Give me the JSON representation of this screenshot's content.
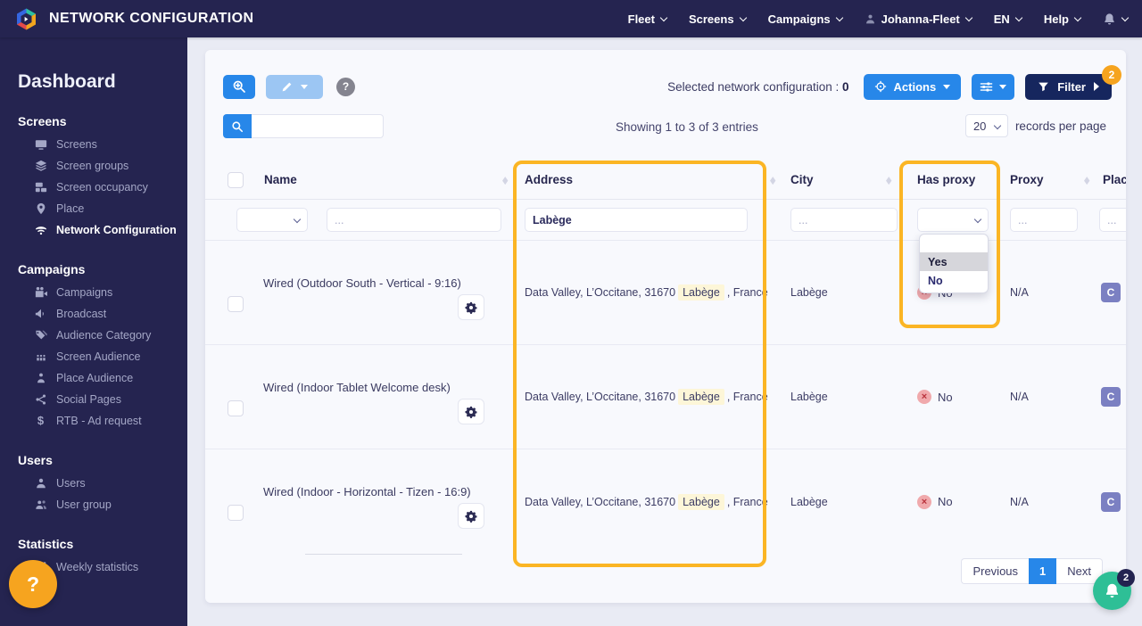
{
  "navbar": {
    "title": "NETWORK CONFIGURATION",
    "items": [
      {
        "label": "Fleet"
      },
      {
        "label": "Screens"
      },
      {
        "label": "Campaigns"
      },
      {
        "label": "Johanna-Fleet"
      },
      {
        "label": "EN"
      },
      {
        "label": "Help"
      }
    ]
  },
  "sidebar": {
    "dashboard": "Dashboard",
    "sections": [
      {
        "title": "Screens",
        "items": [
          {
            "label": "Screens"
          },
          {
            "label": "Screen groups"
          },
          {
            "label": "Screen occupancy"
          },
          {
            "label": "Place"
          },
          {
            "label": "Network Configuration"
          }
        ]
      },
      {
        "title": "Campaigns",
        "items": [
          {
            "label": "Campaigns"
          },
          {
            "label": "Broadcast"
          },
          {
            "label": "Audience Category"
          },
          {
            "label": "Screen Audience"
          },
          {
            "label": "Place Audience"
          },
          {
            "label": "Social Pages"
          },
          {
            "label": "RTB - Ad request"
          }
        ]
      },
      {
        "title": "Users",
        "items": [
          {
            "label": "Users"
          },
          {
            "label": "User group"
          }
        ]
      },
      {
        "title": "Statistics",
        "items": [
          {
            "label": "Weekly statistics"
          }
        ]
      }
    ]
  },
  "toolbar": {
    "help_label": "?",
    "selected_label": "Selected network configuration :",
    "selected_count": "0",
    "actions_label": "Actions",
    "filter_label": "Filter",
    "filter_badge": "2"
  },
  "list_controls": {
    "showing_text": "Showing 1 to 3 of 3 entries",
    "per_page_value": "20",
    "per_page_label": "records per page"
  },
  "table": {
    "columns": [
      "Name",
      "Address",
      "City",
      "Has proxy",
      "Proxy",
      "Place"
    ],
    "filters": {
      "name_placeholder": "...",
      "address_value": "Labège",
      "city_placeholder": "...",
      "proxy_placeholder": "...",
      "place_placeholder": "..."
    },
    "has_proxy_options": [
      "Yes",
      "No"
    ],
    "rows": [
      {
        "name": "Wired (Outdoor South - Vertical - 9:16)",
        "address_prefix": "Data Valley, L’Occitane, 31670",
        "address_highlight": "Labège",
        "address_suffix": ", France",
        "city": "Labège",
        "has_proxy": "No",
        "proxy": "N/A",
        "place_badge": "C"
      },
      {
        "name": "Wired (Indoor Tablet Welcome desk)",
        "address_prefix": "Data Valley, L’Occitane, 31670",
        "address_highlight": "Labège",
        "address_suffix": ", France",
        "city": "Labège",
        "has_proxy": "No",
        "proxy": "N/A",
        "place_badge": "C"
      },
      {
        "name": "Wired (Indoor - Horizontal - Tizen - 16:9)",
        "address_prefix": "Data Valley, L’Occitane, 31670",
        "address_highlight": "Labège",
        "address_suffix": ", France",
        "city": "Labège",
        "has_proxy": "No",
        "proxy": "N/A",
        "place_badge": "C"
      }
    ]
  },
  "pagination": {
    "previous_label": "Previous",
    "current_page": "1",
    "next_label": "Next"
  },
  "floating": {
    "help_label": "?",
    "notification_badge": "2"
  },
  "icons": {
    "sort": "◆",
    "cross": "×"
  },
  "colors": {
    "primary_blue": "#2787e9",
    "navy": "#252450",
    "dark_button": "#16265e",
    "badge_orange": "#f6a41f",
    "highlight_border": "#fbb524",
    "success_green": "#2ebf96",
    "danger_red": "#b9323c",
    "address_highlight_bg": "#fdf6d8",
    "place_badge_bg": "#7b80c2"
  }
}
